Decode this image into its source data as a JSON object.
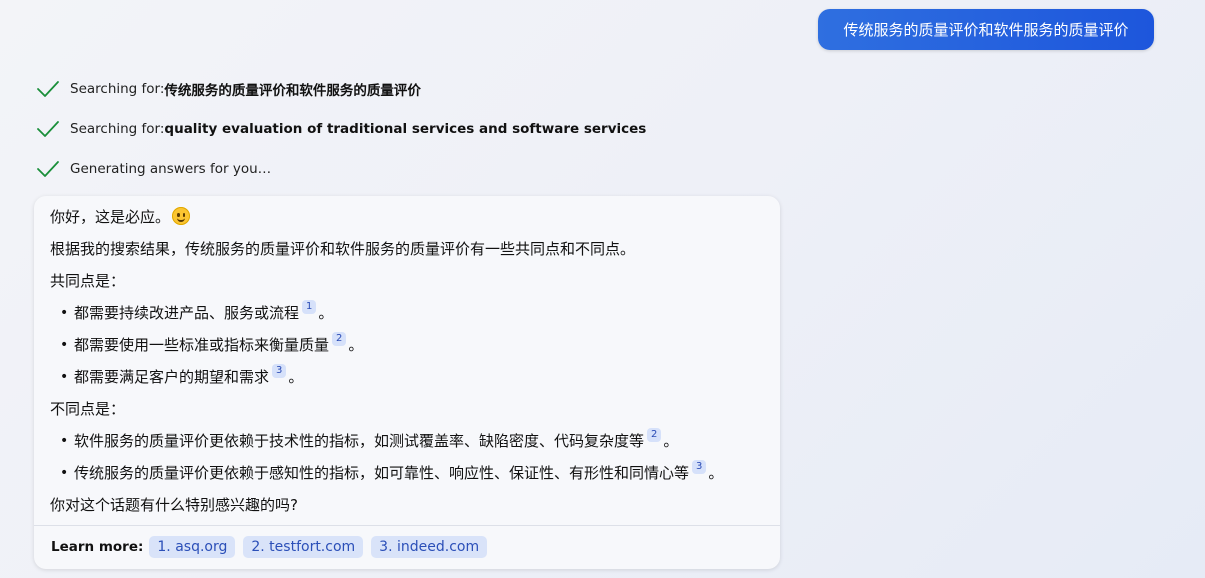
{
  "user_message": "传统服务的质量评价和软件服务的质量评价",
  "status": [
    {
      "prefix": "Searching for: ",
      "query": "传统服务的质量评价和软件服务的质量评价"
    },
    {
      "prefix": "Searching for: ",
      "query": "quality evaluation of traditional services and software services"
    },
    {
      "prefix": "Generating answers for you…",
      "query": ""
    }
  ],
  "answer": {
    "greeting": "你好，这是必应。",
    "intro": "根据我的搜索结果，传统服务的质量评价和软件服务的质量评价有一些共同点和不同点。",
    "common_heading": "共同点是：",
    "common_items": [
      {
        "text": "都需要持续改进产品、服务或流程",
        "ref": "1",
        "end": "。"
      },
      {
        "text": "都需要使用一些标准或指标来衡量质量",
        "ref": "2",
        "end": "。"
      },
      {
        "text": "都需要满足客户的期望和需求",
        "ref": "3",
        "end": "。"
      }
    ],
    "diff_heading": "不同点是：",
    "diff_items": [
      {
        "text": "软件服务的质量评价更依赖于技术性的指标，如测试覆盖率、缺陷密度、代码复杂度等",
        "ref": "2",
        "end": "。"
      },
      {
        "text": "传统服务的质量评价更依赖于感知性的指标，如可靠性、响应性、保证性、有形性和同情心等",
        "ref": "3",
        "end": "。"
      }
    ],
    "question": "你对这个话题有什么特别感兴趣的吗?"
  },
  "learn_more": {
    "label": "Learn more:",
    "links": [
      "1. asq.org",
      "2. testfort.com",
      "3. indeed.com"
    ]
  },
  "colors": {
    "accent": "#1d56dc",
    "check": "#1a8f3a",
    "chip_bg": "#d9e3f9",
    "chip_text": "#2b4fb8"
  }
}
